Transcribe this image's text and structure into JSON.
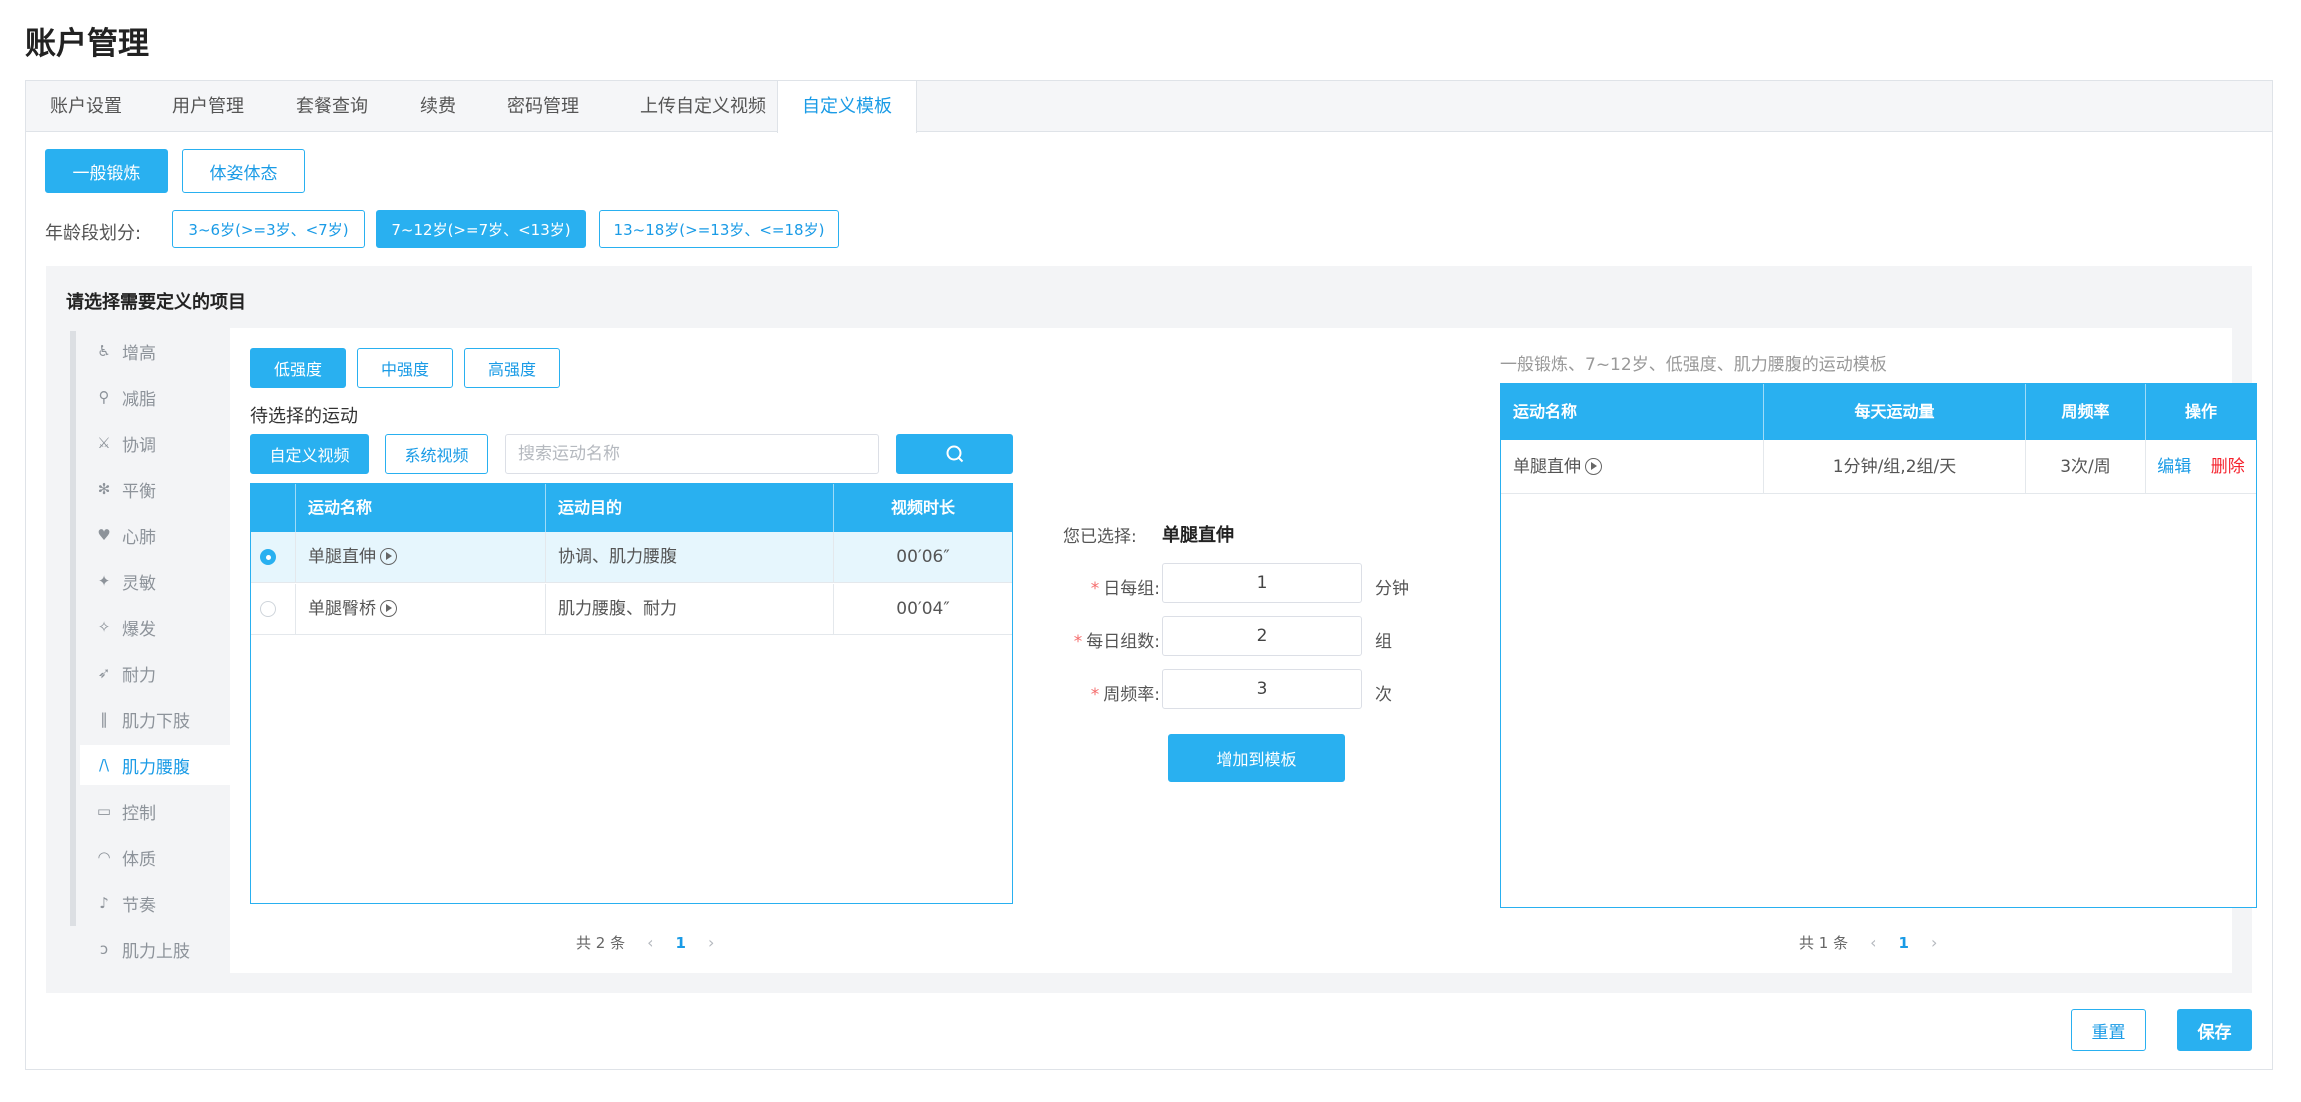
{
  "page_title": "账户管理",
  "tabs": [
    "账户设置",
    "用户管理",
    "套餐查询",
    "续费",
    "密码管理",
    "上传自定义视频",
    "自定义模板"
  ],
  "active_tab": 6,
  "modes": [
    "一般锻炼",
    "体姿体态"
  ],
  "age_label": "年龄段划分:",
  "age_groups": [
    "3~6岁(>=3岁、<7岁)",
    "7~12岁(>=7岁、<13岁)",
    "13~18岁(>=13岁、<=18岁)"
  ],
  "section_title": "请选择需要定义的项目",
  "categories": [
    "增高",
    "减脂",
    "协调",
    "平衡",
    "心肺",
    "灵敏",
    "爆发",
    "耐力",
    "肌力下肢",
    "肌力腰腹",
    "控制",
    "体质",
    "节奏",
    "肌力上肢"
  ],
  "active_category": 9,
  "intensity": [
    "低强度",
    "中强度",
    "高强度"
  ],
  "pending_label": "待选择的运动",
  "video_types": [
    "自定义视频",
    "系统视频"
  ],
  "search_placeholder": "搜索运动名称",
  "left_table": {
    "headers": [
      "运动名称",
      "运动目的",
      "视频时长"
    ],
    "rows": [
      {
        "name": "单腿直伸",
        "purpose": "协调、肌力腰腹",
        "duration": "00′06″",
        "checked": true
      },
      {
        "name": "单腿臀桥",
        "purpose": "肌力腰腹、耐力",
        "duration": "00′04″",
        "checked": false
      }
    ],
    "total": "共 2 条",
    "page": "1"
  },
  "form": {
    "selected_label": "您已选择:",
    "selected_value": "单腿直伸",
    "fields": [
      {
        "label": "日每组:",
        "value": "1",
        "unit": "分钟"
      },
      {
        "label": "每日组数:",
        "value": "2",
        "unit": "组"
      },
      {
        "label": "周频率:",
        "value": "3",
        "unit": "次"
      }
    ],
    "add_button": "增加到模板"
  },
  "right_table": {
    "caption": "一般锻炼、7~12岁、低强度、肌力腰腹的运动模板",
    "headers": [
      "运动名称",
      "每天运动量",
      "周频率",
      "操作"
    ],
    "rows": [
      {
        "name": "单腿直伸",
        "amount": "1分钟/组,2组/天",
        "freq": "3次/周",
        "edit": "编辑",
        "delete": "删除"
      }
    ],
    "total": "共 1 条",
    "page": "1"
  },
  "footer": {
    "reset": "重置",
    "save": "保存"
  }
}
